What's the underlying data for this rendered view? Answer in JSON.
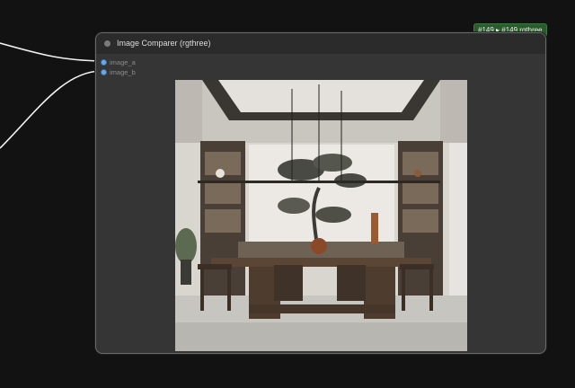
{
  "node": {
    "title": "Image Comparer (rgthree)",
    "badge": "#149 ▸ #149 rgthree",
    "inputs": [
      {
        "label": "image_a"
      },
      {
        "label": "image_b"
      }
    ]
  },
  "colors": {
    "canvas_bg": "#121212",
    "node_bg": "#353535",
    "node_header": "#2b2b2b",
    "slot_color": "#6fa8e8",
    "badge_bg": "#2c5a2f",
    "wire": "#f0f0f0"
  },
  "preview": {
    "description_icon": "image-preview"
  }
}
